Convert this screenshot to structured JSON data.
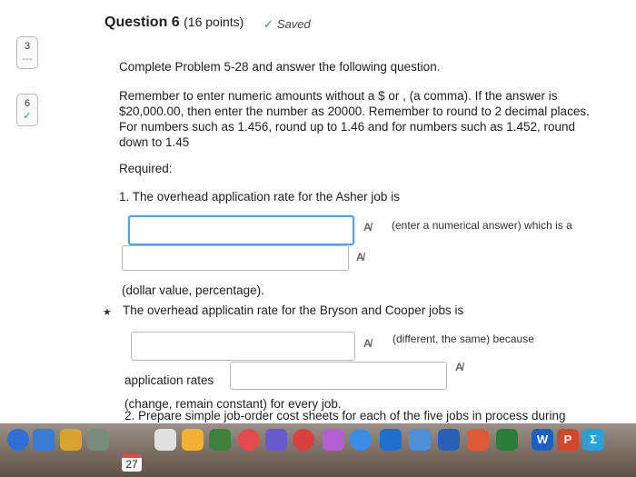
{
  "question": {
    "title": "Question 6",
    "points": "(16 points)",
    "saved_label": "Saved"
  },
  "nav": [
    {
      "number": "3",
      "state": "---"
    },
    {
      "number": "6",
      "state": "✓"
    }
  ],
  "content": {
    "intro": "Complete Problem 5-28 and answer the following question.",
    "instructions": "Remember to enter numeric amounts without a $ or , (a comma). If the answer is $20,000.00, then enter the number as 20000. Remember to round to 2 decimal places. For numbers such as 1.456, round up to 1.46 and for numbers such as 1.452, round down to 1.45",
    "required": "Required:",
    "item1": "1. The overhead application rate for the Asher job is",
    "item1_hint": "(enter a numerical answer) which is a",
    "item1_tail": "(dollar value, percentage).",
    "item1b": "The overhead applicatin rate for the Bryson and Cooper jobs is",
    "item1b_hint": "(different, the same) because",
    "app_rates": "application rates",
    "item1b_tail": "(change, remain constant) for every job.",
    "item2": "2. Prepare simple job-order cost sheets for each of the five jobs in process during"
  },
  "dock": {
    "calendar_day": "27",
    "icon_colors": [
      "#2f6fd6",
      "#3a7bd5",
      "#d6a42f",
      "#7a8b7c",
      "#e0e0e0",
      "#f2b134",
      "#3f7f3f",
      "#e14b4b",
      "#6a5acd",
      "#d94040",
      "#b060d0",
      "#3b8ee8",
      "#1f6fcf",
      "#4f8ed9",
      "#2b5fb3",
      "#e05a3a",
      "#2a7e3b"
    ],
    "word_letter": "W",
    "ppt_letter": "P",
    "sum_symbol": "Σ"
  }
}
